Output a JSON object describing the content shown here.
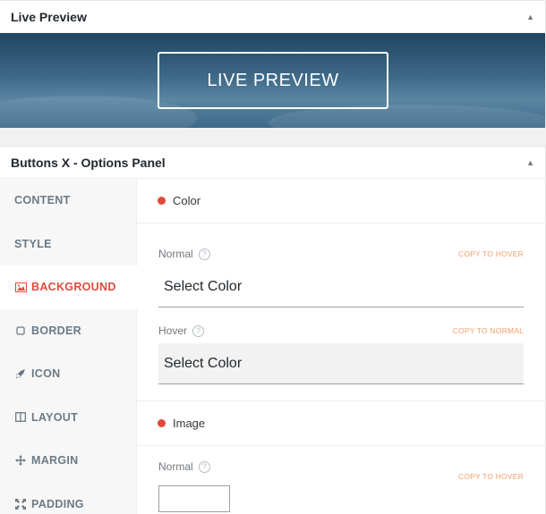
{
  "preview": {
    "title": "Live Preview",
    "button_label": "LIVE PREVIEW",
    "toggle_icon": "triangle-up-icon"
  },
  "options": {
    "title": "Buttons X - Options Panel",
    "toggle_icon": "triangle-up-icon",
    "sidebar": [
      {
        "label": "CONTENT",
        "icon": "",
        "active": false
      },
      {
        "label": "STYLE",
        "icon": "",
        "active": false
      },
      {
        "label": "BACKGROUND",
        "icon": "image-icon",
        "active": true
      },
      {
        "label": "BORDER",
        "icon": "square-icon",
        "active": false
      },
      {
        "label": "ICON",
        "icon": "rocket-icon",
        "active": false
      },
      {
        "label": "LAYOUT",
        "icon": "columns-icon",
        "active": false
      },
      {
        "label": "MARGIN",
        "icon": "move-icon",
        "active": false
      },
      {
        "label": "PADDING",
        "icon": "expand-icon",
        "active": false
      }
    ],
    "color_section": {
      "title": "Color",
      "normal_label": "Normal",
      "normal_copy": "COPY TO HOVER",
      "normal_value": "Select Color",
      "hover_label": "Hover",
      "hover_copy": "COPY TO NORMAL",
      "hover_value": "Select Color"
    },
    "image_section": {
      "title": "Image",
      "normal_label": "Normal",
      "normal_copy": "COPY TO HOVER"
    }
  },
  "colors": {
    "accent": "#e0493a",
    "copy_link": "#f0a06a"
  }
}
